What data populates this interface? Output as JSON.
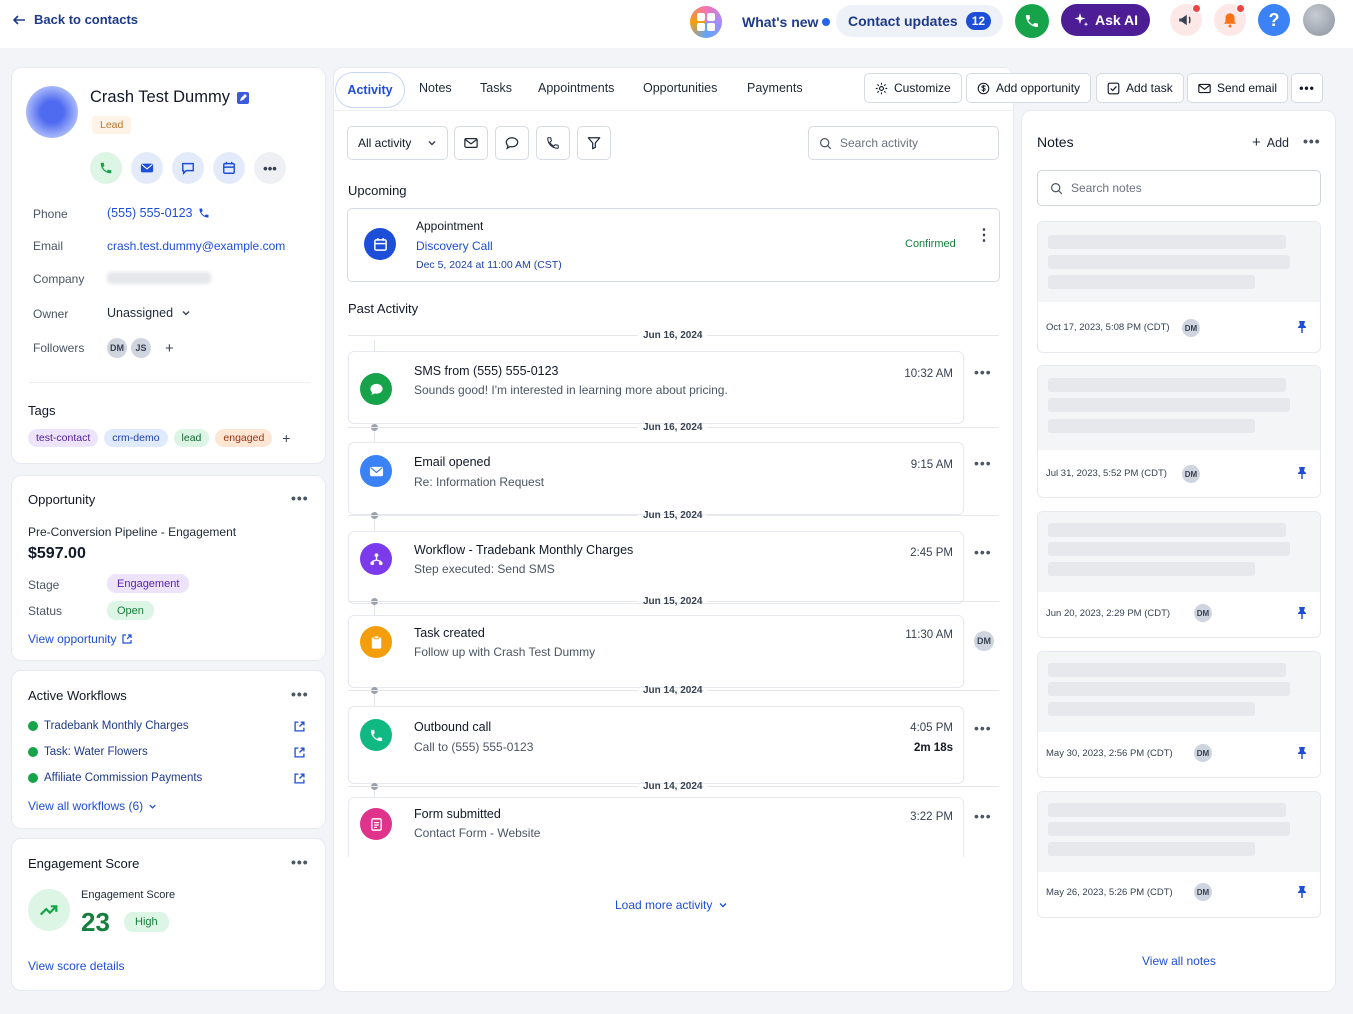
{
  "topbar": {
    "back_label": "Back to contacts",
    "whats_new": "What's new",
    "contact_updates": "Contact updates",
    "contact_updates_count": "12",
    "ask_ai": "Ask AI",
    "help": "?"
  },
  "contact": {
    "name": "Crash Test Dummy",
    "badge": "Lead",
    "fields": [
      {
        "label": "Phone",
        "value": "(555) 555-0123"
      },
      {
        "label": "Email",
        "value": "crash.test.dummy@example.com"
      },
      {
        "label": "Company",
        "value": ""
      },
      {
        "label": "Owner",
        "value": "Unassigned"
      },
      {
        "label": "Followers",
        "value": ""
      }
    ],
    "followers": [
      "DM",
      "JS"
    ],
    "tags_title": "Tags",
    "tags": [
      "test-contact",
      "crm-demo",
      "lead",
      "engaged"
    ],
    "add_symbol": "+"
  },
  "opportunity": {
    "title": "Opportunity",
    "pipeline": "Pre-Conversion Pipeline - Engagement",
    "amount": "$597.00",
    "stage_label": "Stage",
    "stage_value": "Engagement",
    "status_label": "Status",
    "status_value": "Open",
    "link": "View opportunity"
  },
  "workflows": {
    "title": "Active Workflows",
    "items": [
      "Tradebank Monthly Charges",
      "Task: Water Flowers",
      "Affiliate Commission Payments"
    ],
    "link": "View all workflows (6)"
  },
  "engagement": {
    "title": "Engagement Score",
    "label": "Engagement Score",
    "score": "23",
    "level": "High",
    "link": "View score details"
  },
  "tabs": [
    "Activity",
    "Notes",
    "Tasks",
    "Appointments",
    "Opportunities",
    "Payments"
  ],
  "toolbar": {
    "customize": "Customize",
    "add_opportunity": "Add opportunity",
    "add_task": "Add task",
    "send_email": "Send email"
  },
  "filters": {
    "all_activity": "All activity",
    "search_placeholder": "Search activity"
  },
  "upcoming": {
    "heading": "Upcoming",
    "type": "Appointment",
    "title": "Discovery Call",
    "datetime": "Dec 5, 2024 at 11:00 AM (CST)",
    "status": "Confirmed"
  },
  "past_heading": "Past Activity",
  "activities": [
    {
      "date": "Jun 16, 2024",
      "title": "SMS from (555) 555-0123",
      "sub": "Sounds good! I'm interested in learning more about pricing.",
      "time": "10:32 AM",
      "icon": "message-icon",
      "color": "#16a34a"
    },
    {
      "date": "Jun 16, 2024",
      "title": "Email opened",
      "sub": "Re: Information Request",
      "time": "9:15 AM",
      "icon": "mail-icon",
      "color": "#3b82f6"
    },
    {
      "date": "Jun 15, 2024",
      "title": "Workflow - Tradebank Monthly Charges",
      "sub": "Step executed: Send SMS",
      "time": "2:45 PM",
      "icon": "workflow-icon",
      "color": "#7c3aed"
    },
    {
      "date": "Jun 15, 2024",
      "title": "Task created",
      "sub": "Follow up with Crash Test Dummy",
      "time": "11:30 AM",
      "icon": "clipboard-icon",
      "color": "#f59e0b",
      "avatar": "DM"
    },
    {
      "date": "Jun 14, 2024",
      "title": "Outbound call",
      "sub": "Call to (555) 555-0123",
      "time": "4:05 PM",
      "duration": "2m 18s",
      "icon": "phone-icon",
      "color": "#10b981"
    },
    {
      "date": "Jun 14, 2024",
      "title": "Form submitted",
      "sub": "Contact Form - Website",
      "time": "3:22 PM",
      "icon": "form-icon",
      "color": "#e0338b"
    }
  ],
  "load_more": "Load more activity",
  "notes": {
    "title": "Notes",
    "add": "Add",
    "search_placeholder": "Search notes",
    "items": [
      {
        "date": "Oct 17, 2023, 5:08 PM (CDT)",
        "author": "DM"
      },
      {
        "date": "Jul 31, 2023, 5:52 PM (CDT)",
        "author": "DM"
      },
      {
        "date": "Jun 20, 2023, 2:29 PM (CDT)",
        "author": "DM"
      },
      {
        "date": "May 30, 2023, 2:56 PM (CDT)",
        "author": "DM"
      },
      {
        "date": "May 26, 2023, 5:26 PM (CDT)",
        "author": "DM"
      }
    ],
    "view_all": "View all notes"
  },
  "colors": {
    "primary": "#1d4ed8",
    "green": "#16a34a",
    "purple": "#4c1d95",
    "orange": "#f59e0b"
  }
}
